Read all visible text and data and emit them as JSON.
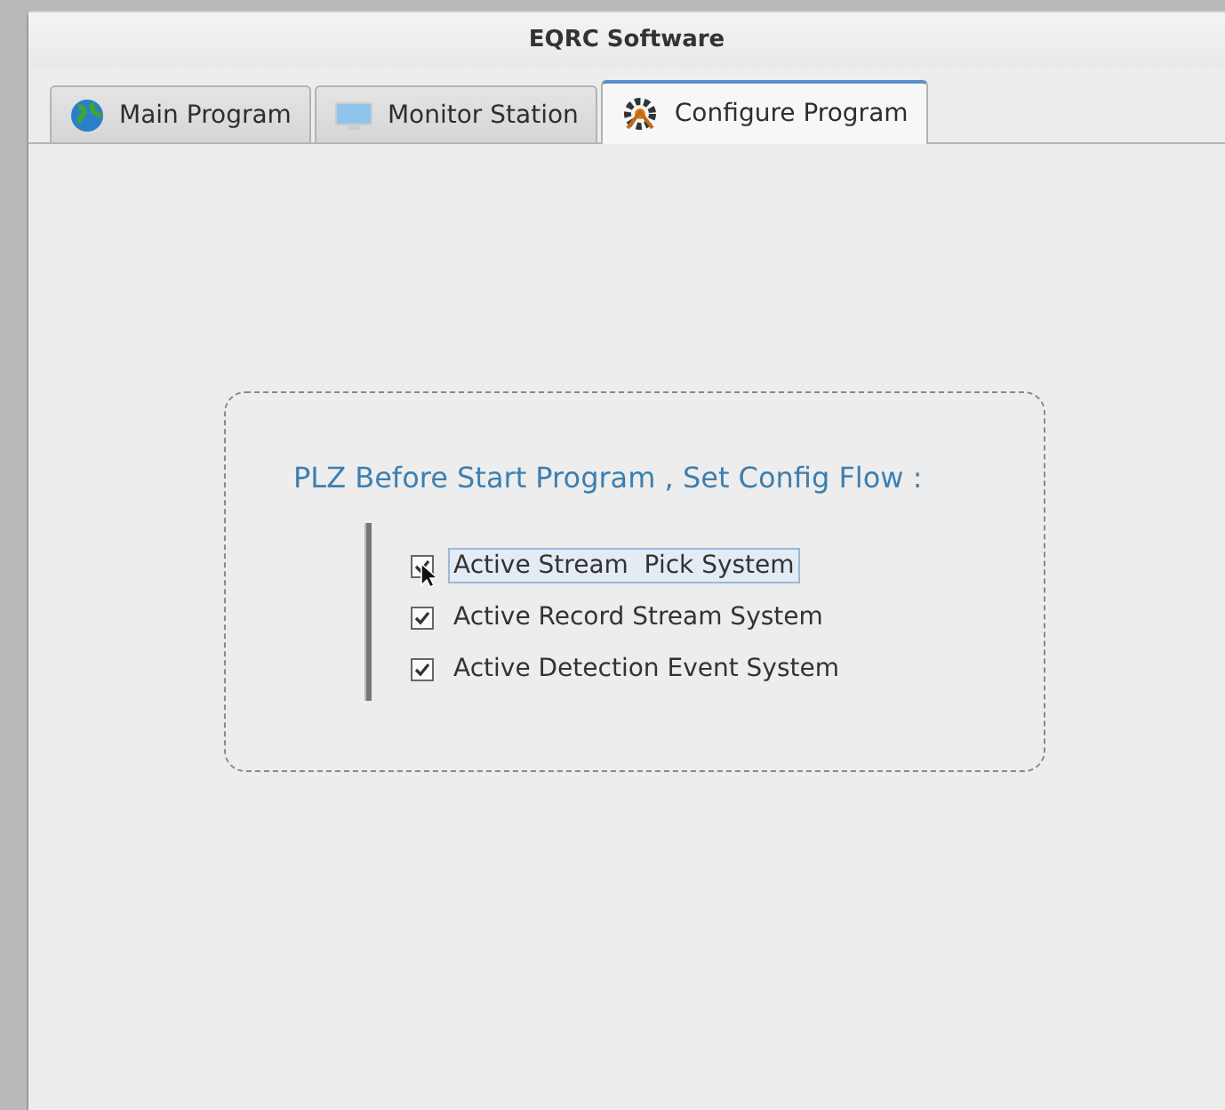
{
  "window": {
    "title": "EQRC Software"
  },
  "tabs": [
    {
      "label": "Main Program",
      "kind": "globe",
      "selected": false
    },
    {
      "label": "Monitor Station",
      "kind": "monitor",
      "selected": false
    },
    {
      "label": "Configure Program",
      "kind": "gear",
      "selected": true
    }
  ],
  "config": {
    "heading": "PLZ Before Start Program , Set Config Flow :",
    "options": [
      {
        "label": "Active Stream  Pick System",
        "checked": true,
        "focused": true
      },
      {
        "label": "Active Record Stream System",
        "checked": true,
        "focused": false
      },
      {
        "label": "Active Detection Event System",
        "checked": true,
        "focused": false
      }
    ]
  }
}
